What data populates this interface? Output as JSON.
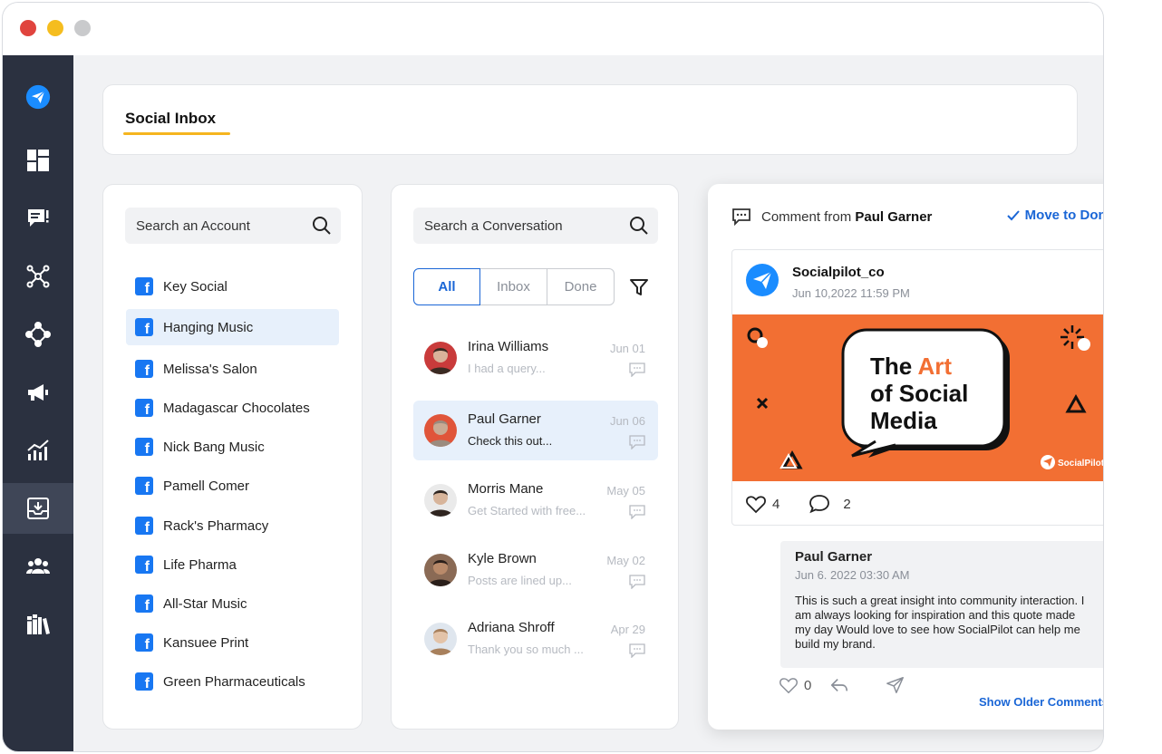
{
  "window": {
    "controls": [
      "close",
      "minimize",
      "maximize"
    ]
  },
  "sidebar": {
    "items": [
      {
        "icon": "socialpilot-logo-icon"
      },
      {
        "icon": "dashboard-icon"
      },
      {
        "icon": "posts-icon"
      },
      {
        "icon": "connections-icon"
      },
      {
        "icon": "integrations-icon"
      },
      {
        "icon": "megaphone-icon"
      },
      {
        "icon": "analytics-icon"
      },
      {
        "icon": "inbox-icon",
        "active": true
      },
      {
        "icon": "team-icon"
      },
      {
        "icon": "library-icon"
      }
    ]
  },
  "header": {
    "title": "Social Inbox"
  },
  "accounts": {
    "search_placeholder": "Search an Account",
    "items": [
      {
        "label": "Key Social"
      },
      {
        "label": "Hanging Music",
        "active": true
      },
      {
        "label": "Melissa's Salon"
      },
      {
        "label": "Madagascar Chocolates"
      },
      {
        "label": "Nick Bang Music"
      },
      {
        "label": "Pamell Comer"
      },
      {
        "label": "Rack's Pharmacy"
      },
      {
        "label": "Life Pharma"
      },
      {
        "label": "All-Star Music"
      },
      {
        "label": "Kansuee Print"
      },
      {
        "label": "Green Pharmaceuticals"
      }
    ]
  },
  "conversations": {
    "search_placeholder": "Search a Conversation",
    "tabs": [
      {
        "label": "All",
        "active": true
      },
      {
        "label": "Inbox"
      },
      {
        "label": "Done"
      }
    ],
    "items": [
      {
        "name": "Irina Williams",
        "preview": "I had a query...",
        "date": "Jun 01"
      },
      {
        "name": "Paul Garner",
        "preview": "Check this out...",
        "date": "Jun 06",
        "active": true
      },
      {
        "name": "Morris Mane",
        "preview": "Get Started with free...",
        "date": "May 05"
      },
      {
        "name": "Kyle Brown",
        "preview": "Posts are lined up...",
        "date": "May 02"
      },
      {
        "name": "Adriana Shroff",
        "preview": "Thank you so much ...",
        "date": "Apr 29"
      }
    ]
  },
  "detail": {
    "heading_prefix": "Comment from",
    "heading_name": "Paul Garner",
    "move_done": "Move to Done",
    "post": {
      "author": "Socialpilot_co",
      "time": "Jun 10,2022 11:59 PM",
      "image_line1a": "The ",
      "image_line1b": "Art",
      "image_line2": "of Social",
      "image_line3": "Media",
      "image_brand": "SocialPilot",
      "likes": "4",
      "comments": "2"
    },
    "comment": {
      "name": "Paul Garner",
      "time": "Jun 6. 2022 03:30 AM",
      "body": "This is such a great insight into community interaction. I am always looking for inspiration and this quote made my day Would love to see how SocialPilot can help me build my brand.",
      "likes": "0"
    },
    "older_comments": "Show Older Comments"
  },
  "colors": {
    "accent": "#1a66d6",
    "sidebar": "#2b3140",
    "highlight": "#e7f0fb",
    "underline": "#f5b51f",
    "post_bg": "#f26f33"
  }
}
